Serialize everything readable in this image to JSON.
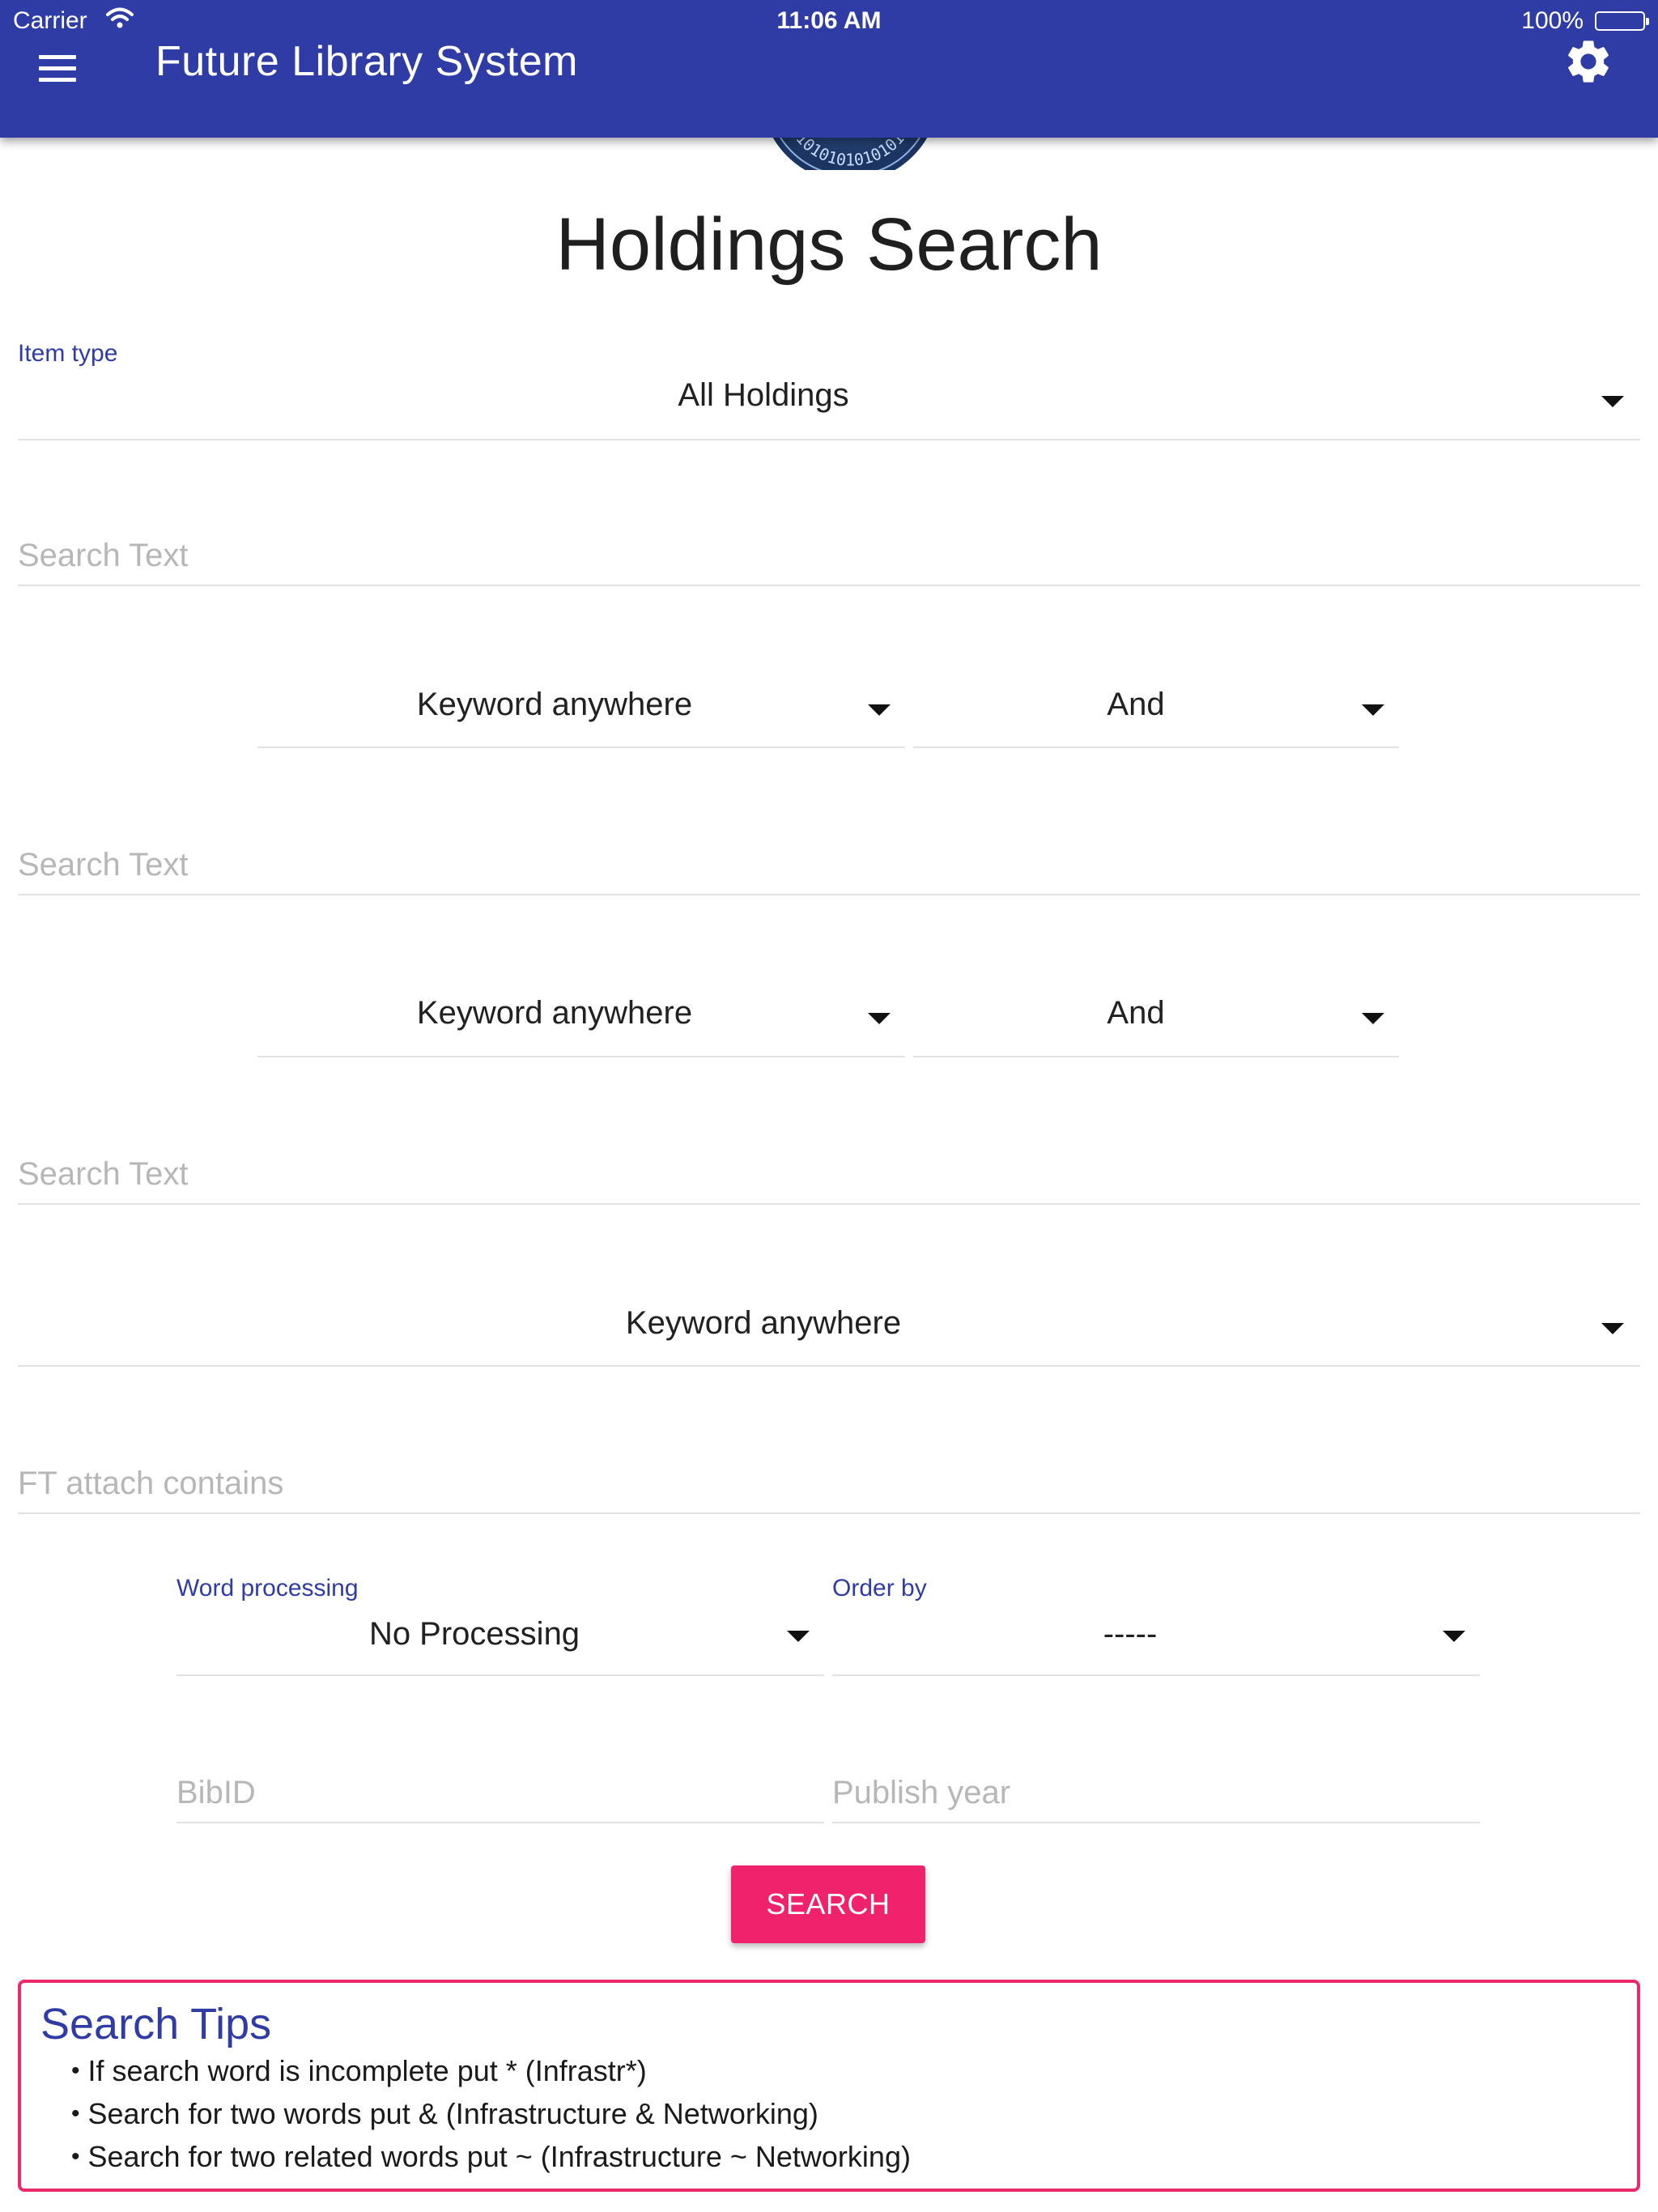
{
  "status_bar": {
    "carrier": "Carrier",
    "time": "11:06 AM",
    "battery": "100%"
  },
  "app_bar": {
    "title": "Future Library System",
    "menu_icon": "hamburger-menu-icon",
    "settings_icon": "gear-icon"
  },
  "logo": {
    "text": "1010101010101"
  },
  "page_title": "Holdings Search",
  "item_type": {
    "label": "Item type",
    "value": "All Holdings"
  },
  "rows": [
    {
      "search_placeholder": "Search Text",
      "field": "Keyword anywhere",
      "operator": "And"
    },
    {
      "search_placeholder": "Search Text",
      "field": "Keyword anywhere",
      "operator": "And"
    },
    {
      "search_placeholder": "Search Text",
      "field": "Keyword anywhere"
    }
  ],
  "ft_attach_placeholder": "FT attach contains",
  "word_processing": {
    "label": "Word processing",
    "value": "No Processing"
  },
  "order_by": {
    "label": "Order by",
    "value": "-----"
  },
  "bibid_placeholder": "BibID",
  "publish_year_placeholder": "Publish year",
  "search_button": "SEARCH",
  "tips": {
    "title": "Search Tips",
    "items": [
      "If search word is incomplete put * (Infrastr*)",
      "Search for two words put & (Infrastructure & Networking)",
      "Search for two related words put ~ (Infrastructure ~ Networking)"
    ]
  },
  "colors": {
    "primary": "#303ca6",
    "accent": "#f0226c",
    "tips_border": "#ea2a6d",
    "placeholder": "#b7b7b7",
    "divider": "#e2e2e2"
  }
}
